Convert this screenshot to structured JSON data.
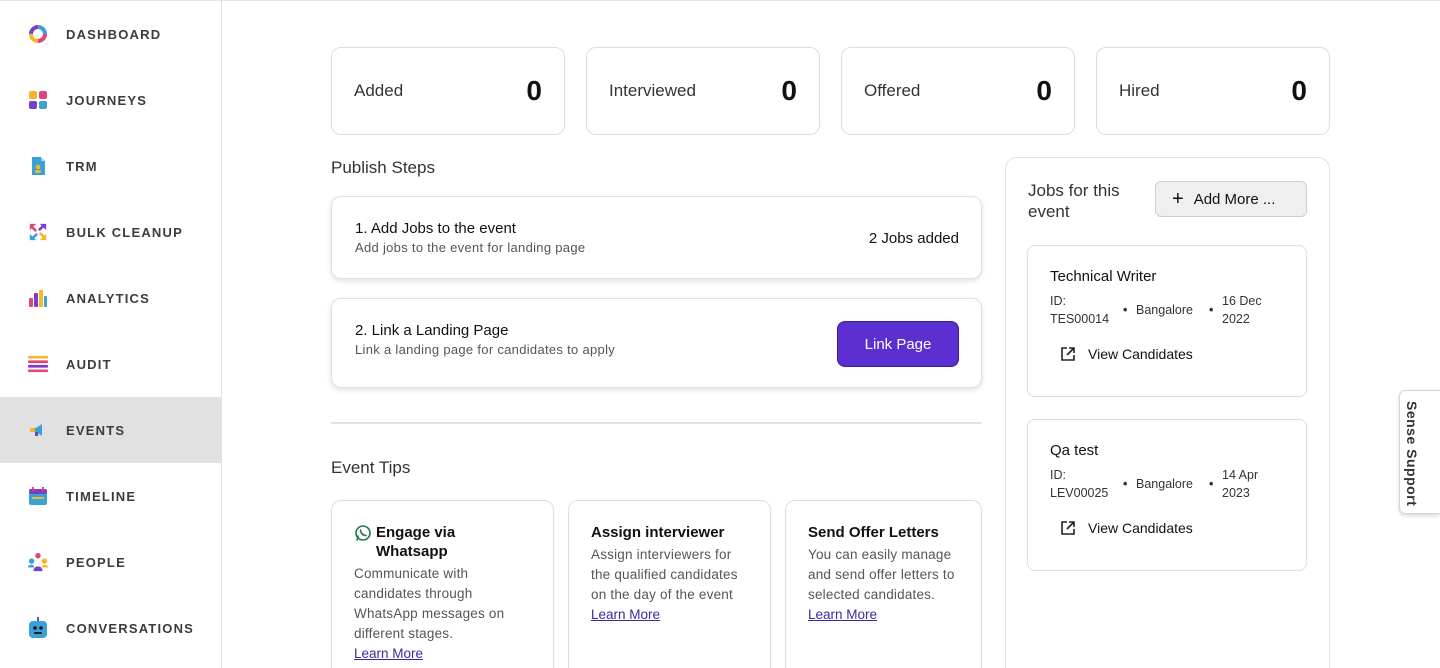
{
  "sidebar": {
    "items": [
      {
        "label": "DASHBOARD",
        "icon": "dashboard-ring-icon",
        "active": false
      },
      {
        "label": "JOURNEYS",
        "icon": "journeys-grid-icon",
        "active": false
      },
      {
        "label": "TRM",
        "icon": "trm-document-icon",
        "active": false
      },
      {
        "label": "BULK CLEANUP",
        "icon": "bulk-cleanup-arrows-icon",
        "active": false
      },
      {
        "label": "ANALYTICS",
        "icon": "analytics-bars-icon",
        "active": false
      },
      {
        "label": "AUDIT",
        "icon": "audit-list-icon",
        "active": false
      },
      {
        "label": "EVENTS",
        "icon": "events-megaphone-icon",
        "active": true
      },
      {
        "label": "TIMELINE",
        "icon": "timeline-calendar-icon",
        "active": false
      },
      {
        "label": "PEOPLE",
        "icon": "people-group-icon",
        "active": false
      },
      {
        "label": "CONVERSATIONS",
        "icon": "conversations-bot-icon",
        "active": false
      }
    ]
  },
  "stats": [
    {
      "label": "Added",
      "value": "0"
    },
    {
      "label": "Interviewed",
      "value": "0"
    },
    {
      "label": "Offered",
      "value": "0"
    },
    {
      "label": "Hired",
      "value": "0"
    }
  ],
  "publish": {
    "title": "Publish Steps",
    "steps": [
      {
        "title": "1. Add Jobs to the event",
        "subtitle": "Add jobs to the event for landing page",
        "status": "2 Jobs added"
      },
      {
        "title": "2. Link a Landing Page",
        "subtitle": "Link a landing page for candidates to apply",
        "button": "Link Page"
      }
    ]
  },
  "tips": {
    "title": "Event Tips",
    "items": [
      {
        "title": "Engage via Whatsapp",
        "body": "Communicate with candidates through WhatsApp messages on different stages.",
        "link": "Learn More"
      },
      {
        "title": "Assign interviewer",
        "body": "Assign interviewers for the qualified candidates on the day of the event",
        "link": "Learn More"
      },
      {
        "title": "Send Offer Letters",
        "body": "You can easily manage and send offer letters to selected candidates.",
        "link": "Learn More"
      }
    ]
  },
  "jobs": {
    "title": "Jobs for this event",
    "add_button": "Add More ...",
    "items": [
      {
        "title": "Technical Writer",
        "id_label": "ID:",
        "id": "TES00014",
        "location": "Bangalore",
        "date": "16 Dec 2022",
        "link": "View Candidates"
      },
      {
        "title": "Qa test",
        "id_label": "ID:",
        "id": "LEV00025",
        "location": "Bangalore",
        "date": "14 Apr 2023",
        "link": "View Candidates"
      }
    ]
  },
  "support": {
    "label": "Sense Support"
  },
  "colors": {
    "primary": "#5b2fd0",
    "active_nav": "#e1e1e1",
    "link": "#3b2aa3"
  }
}
